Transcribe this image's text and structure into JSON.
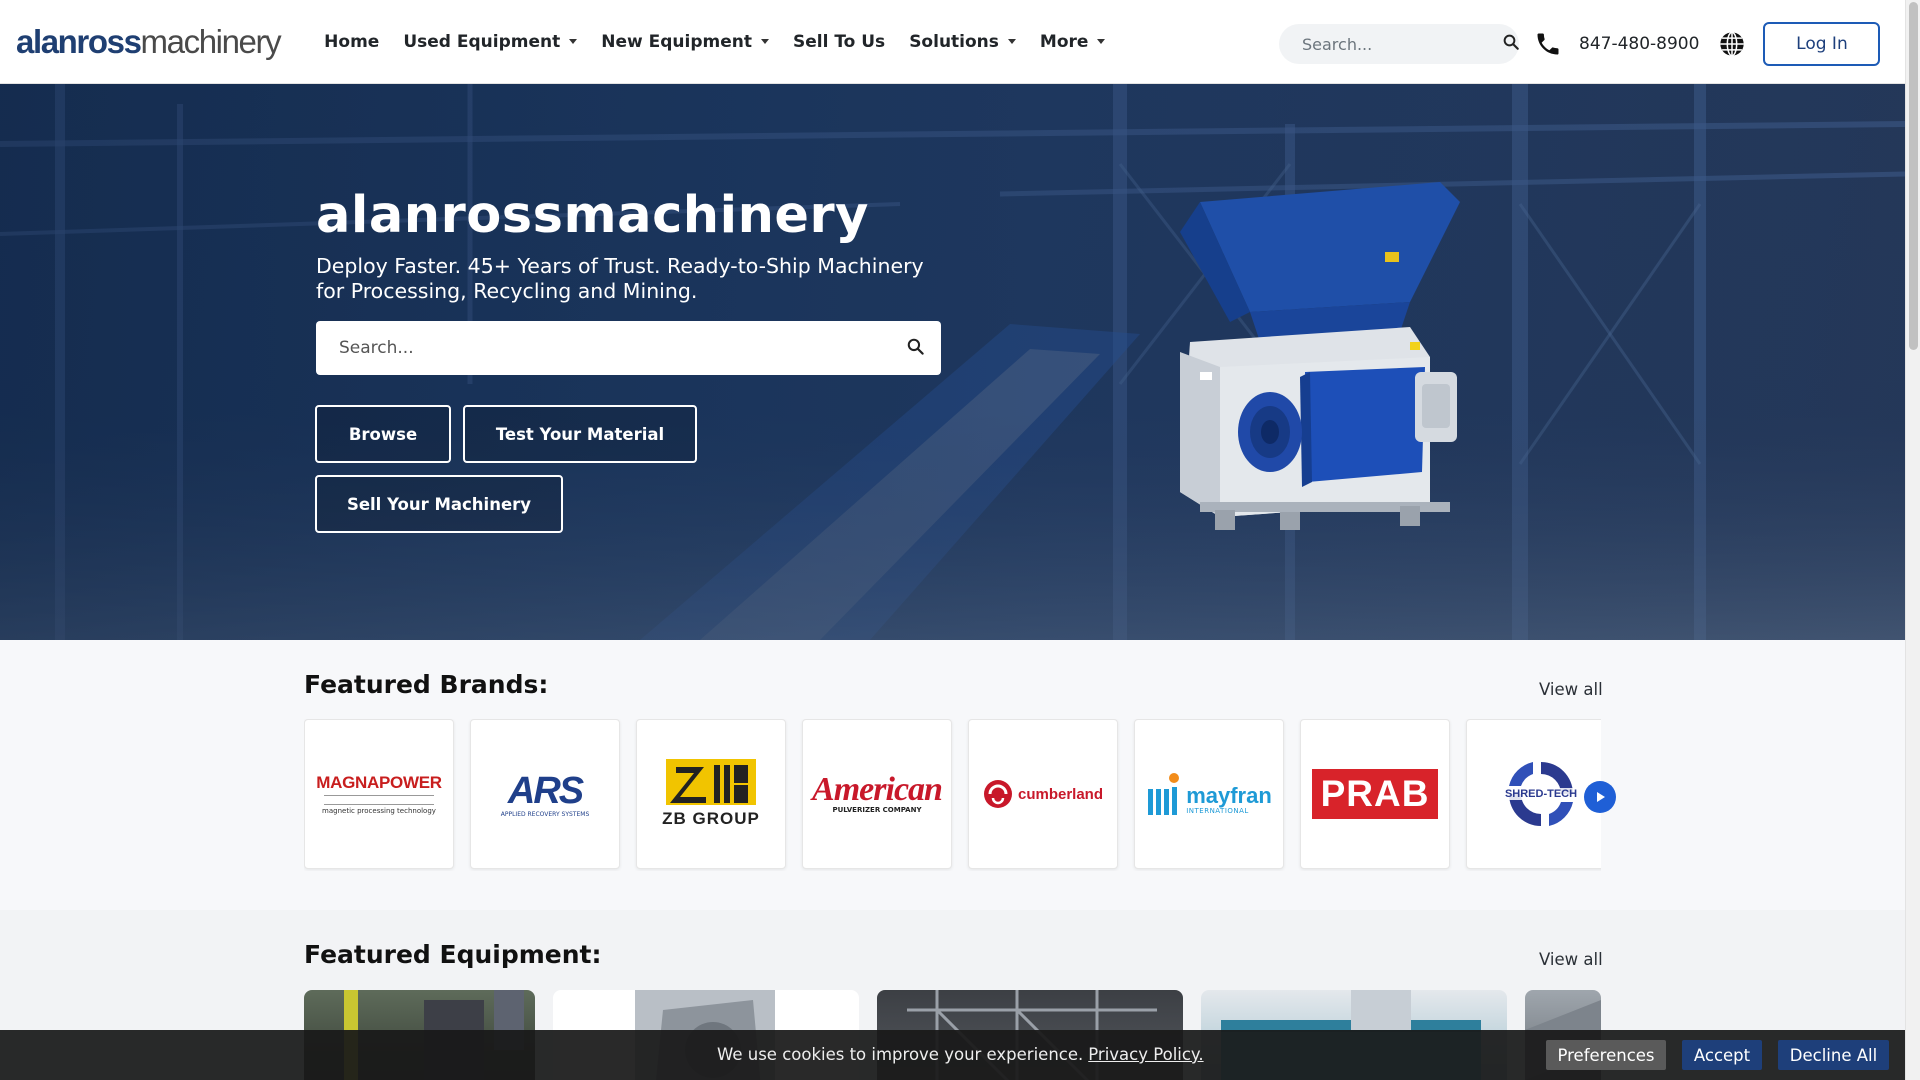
{
  "header": {
    "logo_bold": "alanross",
    "logo_rest": "machinery",
    "nav": [
      {
        "label": "Home",
        "dropdown": false
      },
      {
        "label": "Used Equipment",
        "dropdown": true
      },
      {
        "label": "New Equipment",
        "dropdown": true
      },
      {
        "label": "Sell To Us",
        "dropdown": false
      },
      {
        "label": "Solutions",
        "dropdown": true
      },
      {
        "label": "More",
        "dropdown": true
      }
    ],
    "search_placeholder": "Search...",
    "phone": "847-480-8900",
    "login_label": "Log In"
  },
  "hero": {
    "title": "alanrossmachinery",
    "subtitle": "Deploy Faster. 45+ Years of Trust. Ready-to-Ship Machinery for Processing, Recycling and Mining.",
    "search_placeholder": "Search...",
    "buttons": {
      "browse": "Browse",
      "test": "Test Your Material",
      "sell": "Sell Your Machinery"
    }
  },
  "brands": {
    "title": "Featured Brands:",
    "view_all": "View all",
    "items": [
      {
        "name": "MAGNAPOWER",
        "tagline": "magnetic processing technology"
      },
      {
        "name": "ARS",
        "tagline": "APPLIED RECOVERY SYSTEMS"
      },
      {
        "name": "ZB GROUP",
        "tagline": ""
      },
      {
        "name": "American",
        "tagline": "PULVERIZER COMPANY"
      },
      {
        "name": "cumberland",
        "tagline": ""
      },
      {
        "name": "mayfran",
        "tagline": "INTERNATIONAL"
      },
      {
        "name": "PRAB",
        "tagline": ""
      },
      {
        "name": "SHRED-TECH",
        "tagline": ""
      }
    ]
  },
  "equipment": {
    "title": "Featured Equipment:",
    "view_all": "View all"
  },
  "cookie": {
    "text": "We use cookies to improve your experience.",
    "link": "Privacy Policy.",
    "preferences": "Preferences",
    "accept": "Accept",
    "decline": "Decline All"
  },
  "colors": {
    "brand_blue": "#1f3f72",
    "accent_blue": "#1d5bb6",
    "accept_blue": "#1e3f7a"
  }
}
